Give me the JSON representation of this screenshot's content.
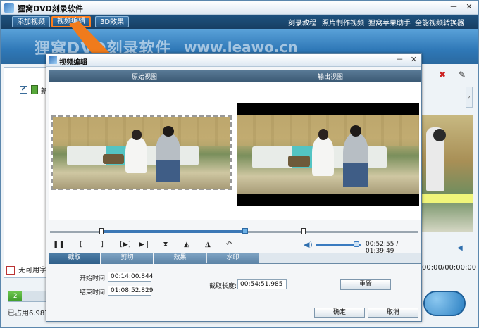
{
  "app": {
    "title": "狸窝DVD刻录软件",
    "window_controls": {
      "minimize": "－",
      "close": "✕"
    }
  },
  "toolbar": {
    "add_video": "添加视频",
    "video_edit": "视频编辑",
    "effect_3d": "3D效果",
    "links": [
      "刻录教程",
      "照片制作视频",
      "狸窝苹果助手",
      "全能视频转换器"
    ]
  },
  "banner": {
    "brand": "狸窝DVD刻录软件",
    "url": "www.leawo.cn"
  },
  "left_panel": {
    "item_label": "新",
    "warning_text": "无可用宇",
    "progress_label": "2",
    "progress_percent": 36,
    "used_text": "已占用6.987"
  },
  "right_strip": {
    "time_text": "00:00/00:00:00"
  },
  "dialog": {
    "title": "视频编辑",
    "controls": {
      "minimize": "－",
      "close": "✕"
    },
    "original_view_label": "原始视图",
    "output_view_label": "输出视图",
    "playback": {
      "play_pause": "❚❚",
      "mark_in": "[",
      "mark_out": "]",
      "next_frame": "[▶]",
      "go_end": "▶❙",
      "time_current": "00:52:55",
      "time_total": "01:39:49",
      "time_separator": " / ",
      "volume_level_percent": 90
    },
    "timeline": {
      "selection_start_percent": 14,
      "playhead_percent": 53,
      "selection_end_percent": 69
    },
    "tabs": [
      "截取",
      "剪切",
      "效果",
      "水印"
    ],
    "active_tab": "截取",
    "trim": {
      "start_label": "开始时间:",
      "start_value": "00:14:00.844",
      "end_label": "结束时间:",
      "end_value": "01:08:52.829",
      "length_label": "截取长度:",
      "length_value": "00:54:51.985",
      "reset_button": "重置"
    },
    "ok_button": "确定",
    "cancel_button": "取消"
  },
  "colors": {
    "accent": "#ff7e1c",
    "toolbar_bg": "#1e527f",
    "banner_bg": "#2f78b7",
    "active_tab": "#2f5f89"
  }
}
